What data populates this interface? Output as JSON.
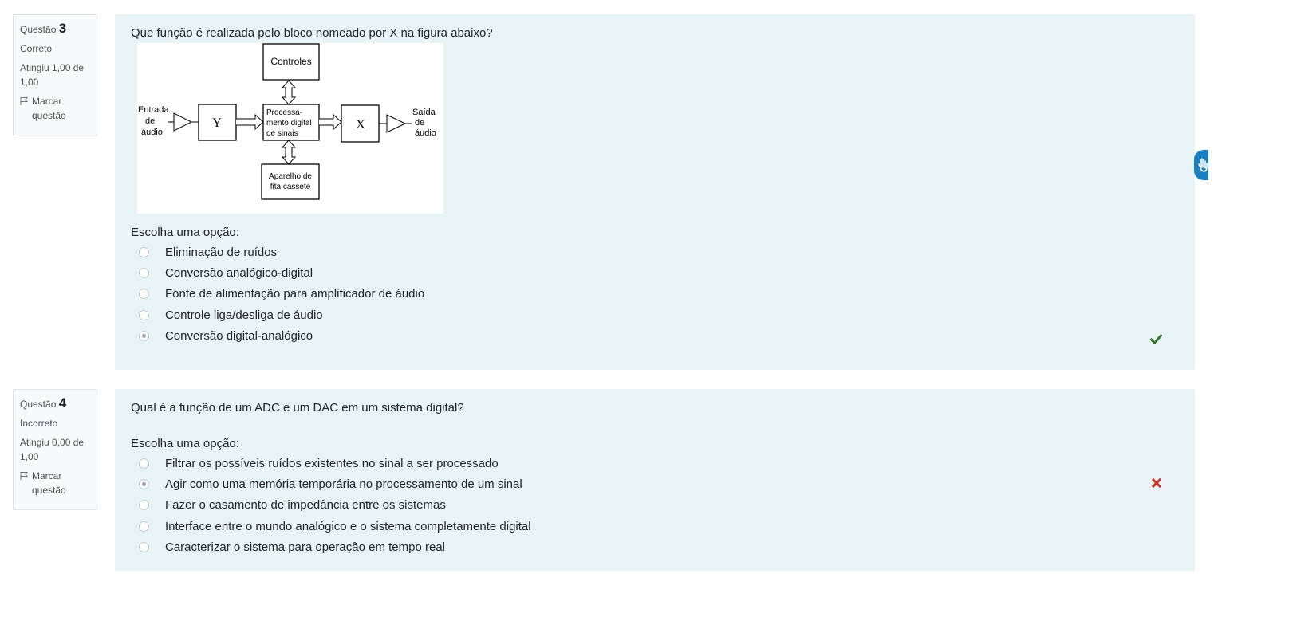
{
  "questions": [
    {
      "label": "Questão",
      "number": "3",
      "status": "Correto",
      "grade": "Atingiu 1,00 de 1,00",
      "flag_label": "Marcar questão",
      "text": "Que função é realizada pelo bloco nomeado por X na figura abaixo?",
      "figure": {
        "controles": "Controles",
        "entrada": [
          "Entrada",
          "de",
          "áudio"
        ],
        "y": "Y",
        "dsp": [
          "Processa-",
          "mento digital",
          "de sinais"
        ],
        "x": "X",
        "saida": [
          "Saída",
          "de",
          "áudio"
        ],
        "aparelho": [
          "Aparelho de",
          "fita cassete"
        ]
      },
      "prompt": "Escolha uma opção:",
      "options": [
        "Eliminação de ruídos",
        "Conversão analógico-digital",
        "Fonte de alimentação para amplificador de áudio",
        "Controle liga/desliga de áudio",
        "Conversão digital-analógico"
      ],
      "selected_index": 4,
      "result_icon": "check-icon",
      "result_color": "#357a32"
    },
    {
      "label": "Questão",
      "number": "4",
      "status": "Incorreto",
      "grade": "Atingiu 0,00 de 1,00",
      "flag_label": "Marcar questão",
      "text": "Qual é a função de um ADC e um DAC em um sistema digital?",
      "prompt": "Escolha uma opção:",
      "options": [
        "Filtrar os possíveis ruídos existentes no sinal a ser processado",
        "Agir como uma memória temporária no processamento de um sinal",
        "Fazer o casamento de impedância entre os sistemas",
        "Interface entre o mundo analógico e o sistema completamente digital",
        "Caracterizar o sistema para operação em tempo real"
      ],
      "selected_index": 1,
      "result_icon": "cross-icon",
      "result_color": "#ca3120"
    }
  ],
  "accessibility_widget_icon": "hand-icon",
  "accessibility_color": "#1a7fc1"
}
